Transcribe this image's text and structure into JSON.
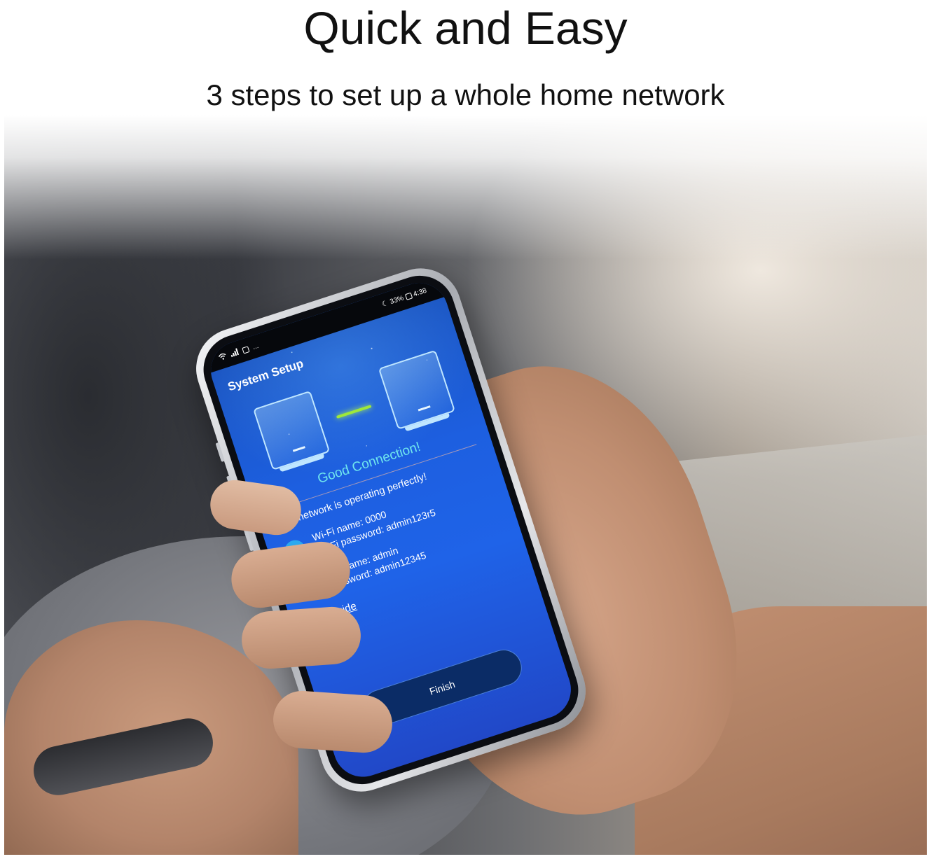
{
  "page": {
    "title": "Quick and Easy",
    "subtitle": "3 steps to set up a whole home network"
  },
  "phone": {
    "status_bar": {
      "battery": "33%",
      "time": "4:38",
      "dots": "..."
    },
    "app_title": "System Setup",
    "connection_status": "Good Connection!",
    "status_message": "Your network is operating perfectly!",
    "wifi_info": {
      "name_line": "Wi-Fi name: 0000",
      "password_line": "Wi-Fi password: admin123r5"
    },
    "account_info": {
      "username_line": "Username: admin",
      "password_line": "Password: admin12345"
    },
    "led_guide_label": "LED Guide",
    "finish_label": "Finish",
    "colors": {
      "screen_blue": "#1f63e8",
      "connection_text": "#6fe6ee",
      "link_green": "#9ee83a",
      "wifi_icon_bg": "#2aa9f0",
      "user_icon_bg": "#28c26b",
      "finish_button_bg": "#0b2c66"
    },
    "icons": [
      "wifi-signal-icon",
      "cell-signal-icon",
      "message-icon",
      "moon-icon",
      "battery-icon",
      "wifi-icon",
      "user-icon"
    ]
  }
}
